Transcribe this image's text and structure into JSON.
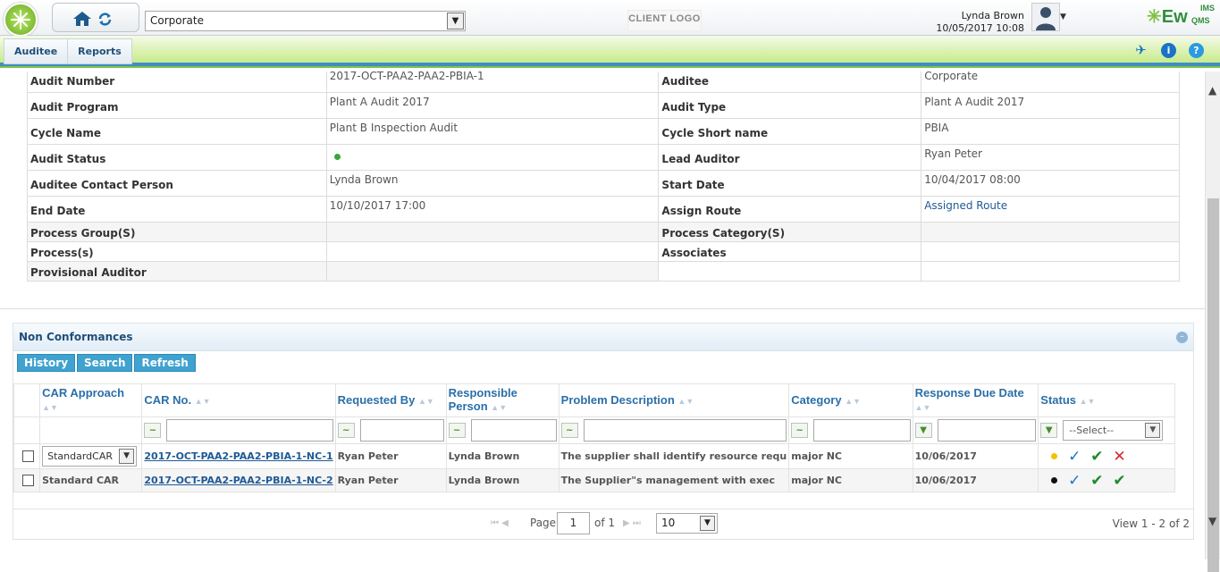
{
  "header": {
    "company_select": "Corporate",
    "client_logo": "CLIENT LOGO",
    "user_name": "Lynda Brown",
    "user_datetime": "10/05/2017 10:08",
    "brand": "Ew",
    "brand_ims": "IMS",
    "brand_qms": "QMS"
  },
  "tabs": [
    "Auditee",
    "Reports"
  ],
  "details": [
    {
      "l1": "Audit Number",
      "v1": "2017-OCT-PAA2-PAA2-PBIA-1",
      "l2": "Auditee",
      "v2": "Corporate"
    },
    {
      "l1": "Audit Program",
      "v1": "Plant A Audit 2017",
      "l2": "Audit Type",
      "v2": "Plant A Audit 2017"
    },
    {
      "l1": "Cycle Name",
      "v1": "Plant B Inspection Audit",
      "l2": "Cycle Short name",
      "v2": "PBIA"
    },
    {
      "l1": "Audit Status",
      "v1": "",
      "l2": "Lead Auditor",
      "v2": "Ryan Peter"
    },
    {
      "l1": "Auditee Contact Person",
      "v1": "Lynda Brown",
      "l2": "Start Date",
      "v2": "10/04/2017 08:00"
    },
    {
      "l1": "End Date",
      "v1": "10/10/2017 17:00",
      "l2": "Assign Route",
      "v2": "Assigned Route"
    },
    {
      "l1": "Process Group(S)",
      "v1": "",
      "l2": "Process Category(S)",
      "v2": ""
    },
    {
      "l1": "Process(s)",
      "v1": "",
      "l2": "Associates",
      "v2": ""
    },
    {
      "l1": "Provisional Auditor",
      "v1": "",
      "l2": "",
      "v2": ""
    }
  ],
  "status_color": "#3aa53a",
  "nc": {
    "title": "Non Conformances",
    "buttons": [
      "History",
      "Search",
      "Refresh"
    ],
    "columns": [
      "CAR Approach",
      "CAR No.",
      "Requested By",
      "Responsible Person",
      "Problem Description",
      "Category",
      "Response Due Date",
      "Status"
    ],
    "status_filter": "--Select--",
    "rows": [
      {
        "approach": "StandardCAR",
        "car_no": "2017-OCT-PAA2-PAA2-PBIA-1-NC-1",
        "requested_by": "Ryan Peter",
        "responsible": "Lynda Brown",
        "problem": "The supplier shall identify resource requ",
        "category": "major NC",
        "due": "10/06/2017",
        "dot_color": "#f2c200"
      },
      {
        "approach": "Standard CAR",
        "car_no": "2017-OCT-PAA2-PAA2-PBIA-1-NC-2",
        "requested_by": "Ryan Peter",
        "responsible": "Lynda Brown",
        "problem": "The Supplier\"s management with exec",
        "category": "major NC",
        "due": "10/06/2017",
        "dot_color": "#111111"
      }
    ],
    "pager": {
      "page_label": "Page",
      "page": "1",
      "of": "of 1",
      "size": "10",
      "view": "View 1 - 2 of 2"
    }
  }
}
